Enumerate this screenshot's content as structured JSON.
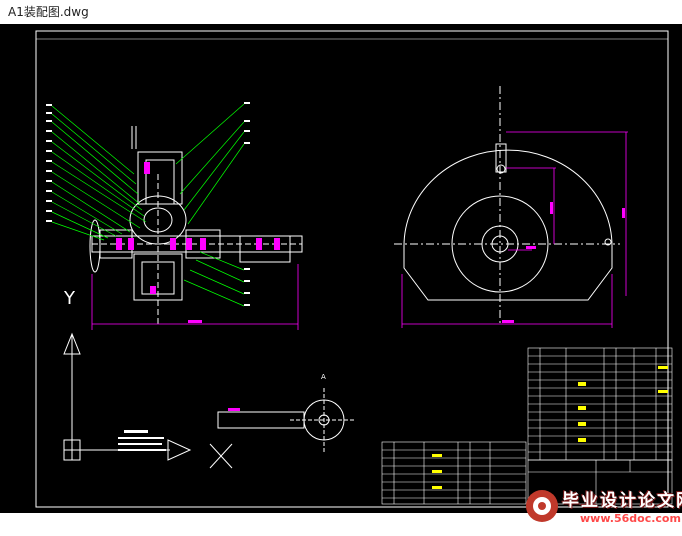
{
  "window": {
    "title": "A1装配图.dwg"
  },
  "axes": {
    "y_label": "Y",
    "x_label": "X"
  },
  "detail": {
    "label": "A"
  },
  "watermark": {
    "text": "毕业设计论文网",
    "url": "www.56doc.com"
  },
  "colors": {
    "background": "#000000",
    "lines": "#ffffff",
    "leaders": "#00ff00",
    "dimensions": "#ff00ff",
    "highlight": "#ffff00"
  }
}
